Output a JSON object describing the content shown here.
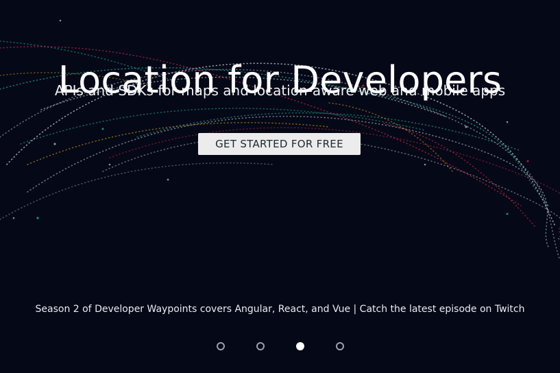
{
  "hero": {
    "title": "Location for Developers",
    "subtitle": "APIs and SDKs for maps and location-aware web and mobile apps",
    "cta_label": "GET STARTED FOR FREE",
    "announcement": "Season 2 of Developer Waypoints covers Angular, React, and Vue | Catch the latest episode on Twitch"
  },
  "carousel": {
    "slide_count": 4,
    "active_index": 2
  },
  "colors": {
    "background": "#050816",
    "cta_background": "#ececec",
    "accent_traces": [
      "#e0305a",
      "#22c7b8",
      "#e8b22b",
      "#ffffff"
    ]
  }
}
